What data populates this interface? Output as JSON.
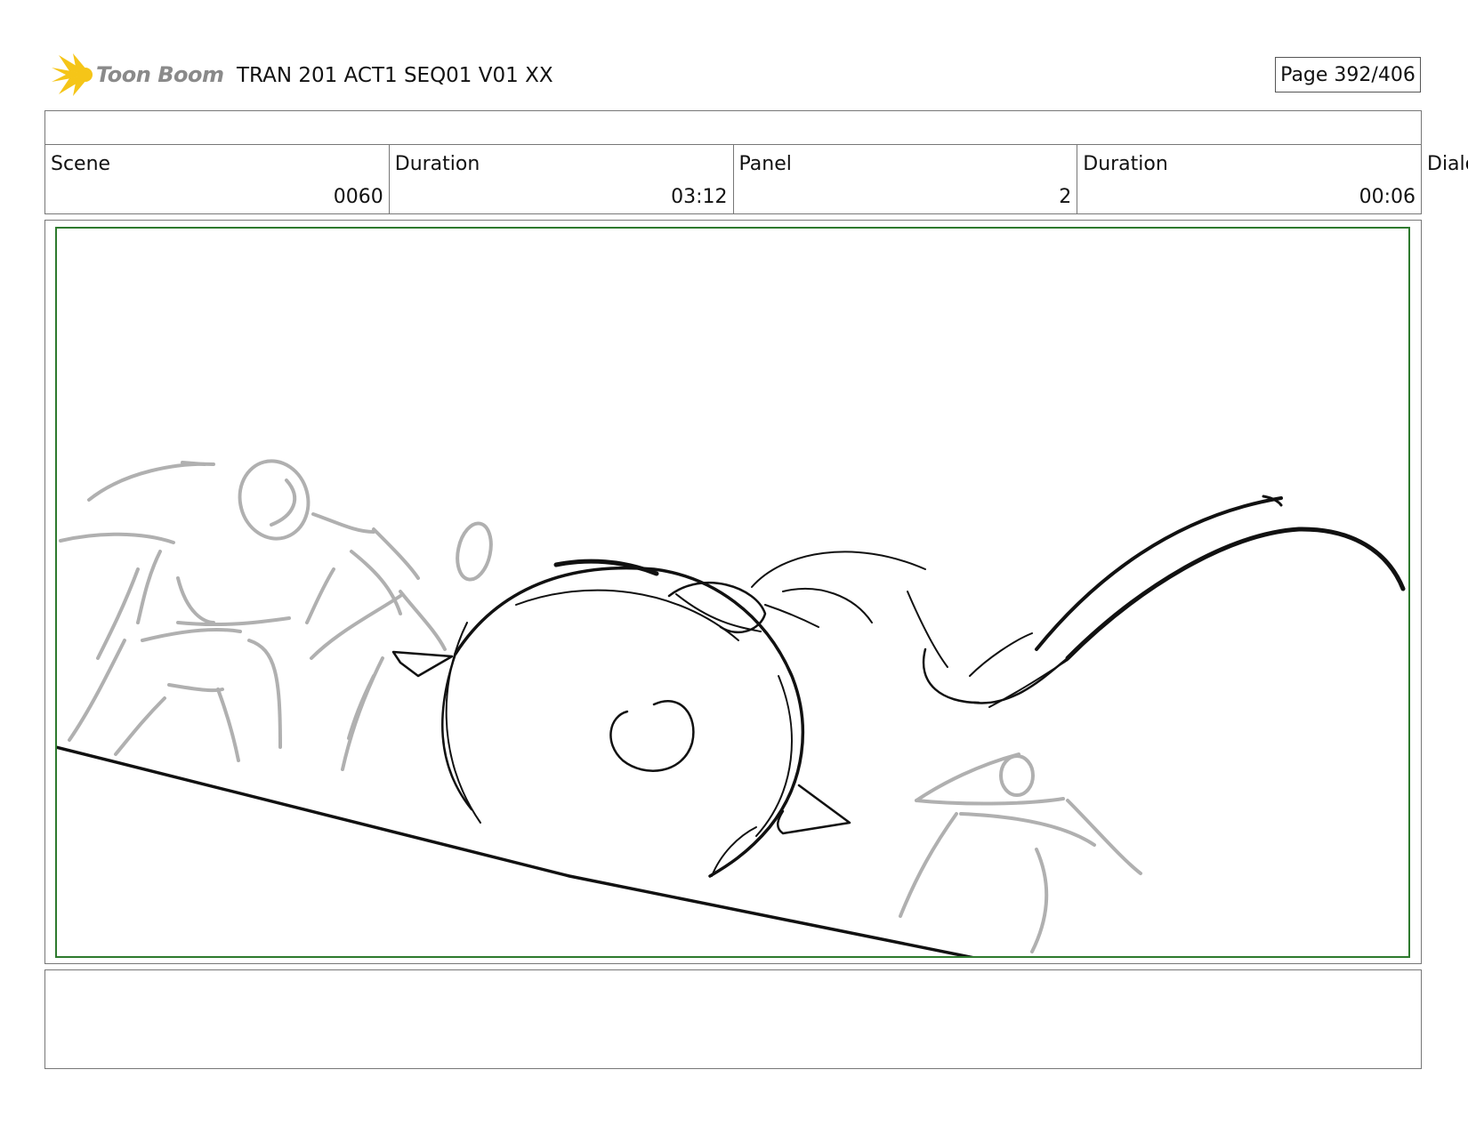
{
  "header": {
    "logo_text": "Toon Boom",
    "project_title": "TRAN 201 ACT1 SEQ01 V01 XX",
    "page_label": "Page 392/406"
  },
  "info": {
    "scene_label": "Scene",
    "scene_value": "0060",
    "scene_duration_label": "Duration",
    "scene_duration_value": "03:12",
    "panel_label": "Panel",
    "panel_value": "2",
    "panel_duration_label": "Duration",
    "panel_duration_value": "00:06",
    "dialog_label": "Dialog"
  },
  "colors": {
    "logo_yellow": "#f5c518",
    "safe_frame_green": "#2e7a2e",
    "sketch_black": "#111111",
    "sketch_gray": "#b0b0b0"
  }
}
